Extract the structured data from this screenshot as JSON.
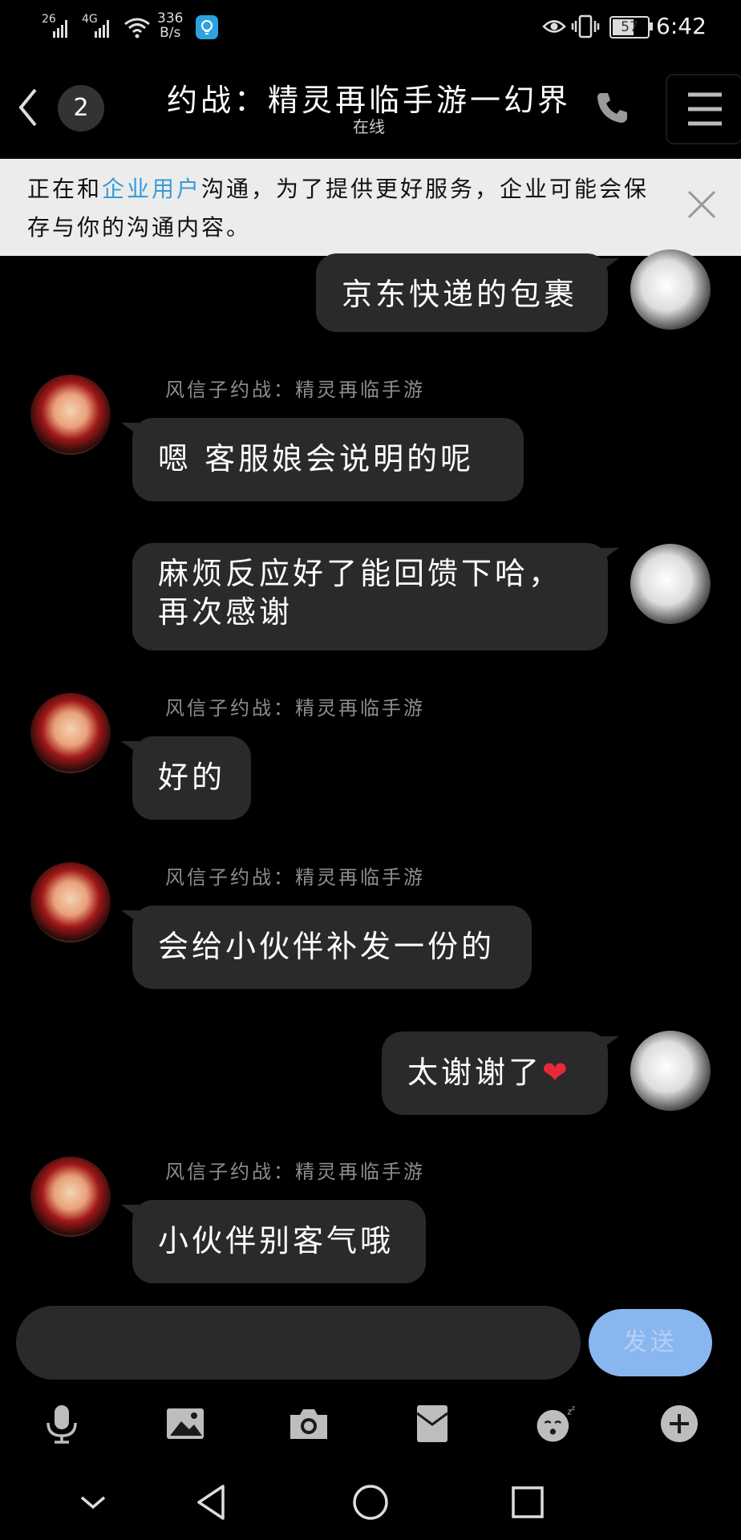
{
  "status_bar": {
    "sig1": "26",
    "sig2": "4G",
    "net_speed_value": "336",
    "net_speed_unit": "B/s",
    "battery": "57",
    "time": "6:42"
  },
  "header": {
    "unread_count": "2",
    "title": "约战：精灵再临手游一幻界",
    "subtitle": "在线"
  },
  "notice": {
    "prefix": "正在和",
    "link": "企业用户",
    "suffix": "沟通，为了提供更好服务，企业可能会保存与你的沟通内容。"
  },
  "messages": [
    {
      "side": "right",
      "text": "京东快递的包裹"
    },
    {
      "side": "left",
      "sender": "风信子约战：精灵再临手游",
      "text": "嗯  客服娘会说明的呢"
    },
    {
      "side": "right",
      "text": "麻烦反应好了能回馈下哈，再次感谢"
    },
    {
      "side": "left",
      "sender": "风信子约战：精灵再临手游",
      "text": "好的"
    },
    {
      "side": "left",
      "sender": "风信子约战：精灵再临手游",
      "text": "会给小伙伴补发一份的"
    },
    {
      "side": "right",
      "text": "太谢谢了",
      "emoji": "❤"
    },
    {
      "side": "left",
      "sender": "风信子约战：精灵再临手游",
      "text": "小伙伴别客气哦"
    }
  ],
  "composer": {
    "placeholder": "",
    "send_label": "发送"
  },
  "toolbar": [
    "microphone-icon",
    "image-icon",
    "camera-icon",
    "red-packet-icon",
    "emoji-icon",
    "plus-icon"
  ],
  "nav_bar": [
    "collapse-icon",
    "back-icon",
    "home-icon",
    "recents-icon"
  ],
  "colors": {
    "background": "#000000",
    "bubble": "#2a2a2a",
    "notice_bg": "#ececec",
    "link": "#3a9ad9",
    "send_button": "#8ab6ef"
  }
}
